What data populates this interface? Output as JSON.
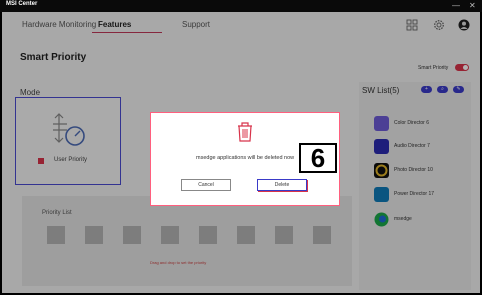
{
  "window": {
    "title": "MSI Center"
  },
  "nav": {
    "tabs": [
      {
        "label": "Hardware Monitoring"
      },
      {
        "label": "Features"
      },
      {
        "label": "Support"
      }
    ]
  },
  "page": {
    "title": "Smart Priority",
    "smart_priority_label": "Smart Priority",
    "smart_priority_on": true
  },
  "mode": {
    "label": "Mode",
    "option": "User Priority"
  },
  "sw_list": {
    "title": "SW List(5)",
    "items": [
      {
        "name": "Color Director 6",
        "color": "#6e5bd6"
      },
      {
        "name": "Audio Director 7",
        "color": "#2b2bb0"
      },
      {
        "name": "Photo Director 10",
        "color": "#c8a023"
      },
      {
        "name": "Power Director 17",
        "color": "#0f7ab8"
      },
      {
        "name": "msedge",
        "color": "#1aa84a"
      }
    ]
  },
  "priority_list": {
    "title": "Priority List",
    "hint": "Drag and drop to set the priority"
  },
  "dialog": {
    "message": "msedge applications will be deleted now",
    "countdown": "6",
    "cancel_label": "Cancel",
    "delete_label": "Delete"
  },
  "colors": {
    "accent": "#d8334a",
    "brand_blue": "#3a3ac8"
  }
}
